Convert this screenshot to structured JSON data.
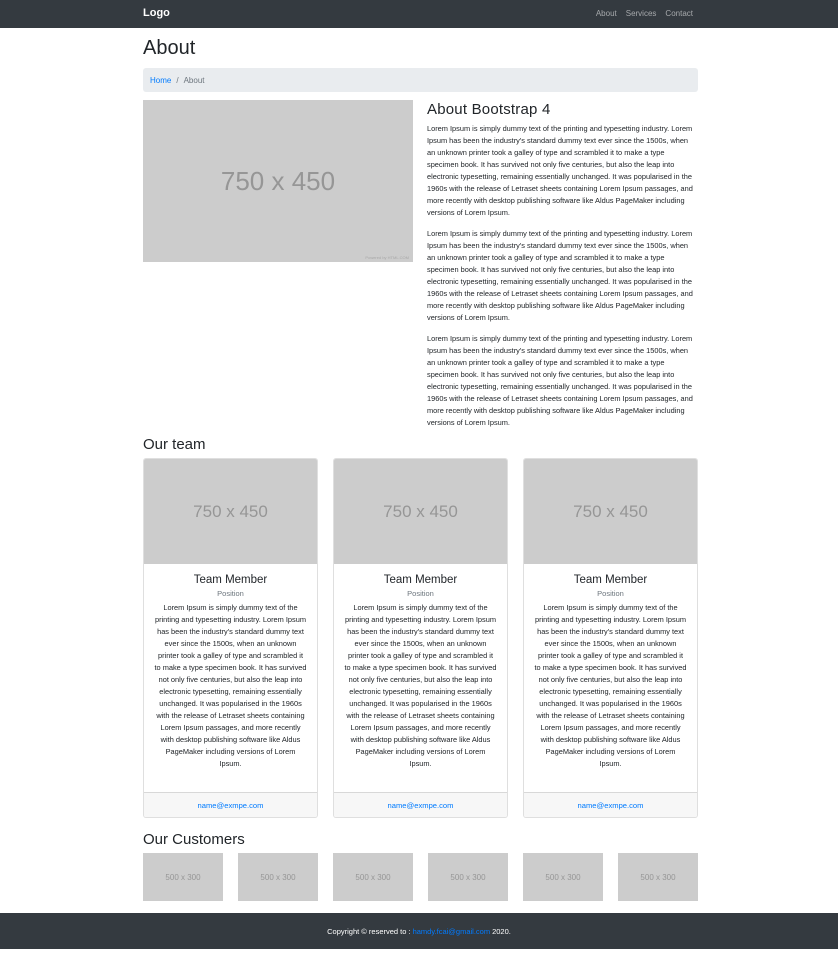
{
  "navbar": {
    "brand": "Logo",
    "links": [
      "About",
      "Services",
      "Contact"
    ]
  },
  "page": {
    "title": "About"
  },
  "breadcrumb": {
    "home": "Home",
    "separator": "/",
    "current": "About"
  },
  "hero": {
    "image_label": "750 x 450",
    "watermark": "Powered by HTML.COM",
    "heading": "About Bootstrap 4",
    "paragraphs": [
      "Lorem Ipsum is simply dummy text of the printing and typesetting industry. Lorem Ipsum has been the industry's standard dummy text ever since the 1500s, when an unknown printer took a galley of type and scrambled it to make a type specimen book. It has survived not only five centuries, but also the leap into electronic typesetting, remaining essentially unchanged. It was popularised in the 1960s with the release of Letraset sheets containing Lorem Ipsum passages, and more recently with desktop publishing software like Aldus PageMaker including versions of Lorem Ipsum.",
      "Lorem Ipsum is simply dummy text of the printing and typesetting industry. Lorem Ipsum has been the industry's standard dummy text ever since the 1500s, when an unknown printer took a galley of type and scrambled it to make a type specimen book. It has survived not only five centuries, but also the leap into electronic typesetting, remaining essentially unchanged. It was popularised in the 1960s with the release of Letraset sheets containing Lorem Ipsum passages, and more recently with desktop publishing software like Aldus PageMaker including versions of Lorem Ipsum.",
      "Lorem Ipsum is simply dummy text of the printing and typesetting industry. Lorem Ipsum has been the industry's standard dummy text ever since the 1500s, when an unknown printer took a galley of type and scrambled it to make a type specimen book. It has survived not only five centuries, but also the leap into electronic typesetting, remaining essentially unchanged. It was popularised in the 1960s with the release of Letraset sheets containing Lorem Ipsum passages, and more recently with desktop publishing software like Aldus PageMaker including versions of Lorem Ipsum."
    ]
  },
  "team": {
    "title": "Our team",
    "members": [
      {
        "image_label": "750 x 450",
        "name": "Team Member",
        "position": "Position",
        "description": "Lorem Ipsum is simply dummy text of the printing and typesetting industry. Lorem Ipsum has been the industry's standard dummy text ever since the 1500s, when an unknown printer took a galley of type and scrambled it to make a type specimen book. It has survived not only five centuries, but also the leap into electronic typesetting, remaining essentially unchanged. It was popularised in the 1960s with the release of Letraset sheets containing Lorem Ipsum passages, and more recently with desktop publishing software like Aldus PageMaker including versions of Lorem Ipsum.",
        "email": "name@exmpe.com"
      },
      {
        "image_label": "750 x 450",
        "name": "Team Member",
        "position": "Position",
        "description": "Lorem Ipsum is simply dummy text of the printing and typesetting industry. Lorem Ipsum has been the industry's standard dummy text ever since the 1500s, when an unknown printer took a galley of type and scrambled it to make a type specimen book. It has survived not only five centuries, but also the leap into electronic typesetting, remaining essentially unchanged. It was popularised in the 1960s with the release of Letraset sheets containing Lorem Ipsum passages, and more recently with desktop publishing software like Aldus PageMaker including versions of Lorem Ipsum.",
        "email": "name@exmpe.com"
      },
      {
        "image_label": "750 x 450",
        "name": "Team Member",
        "position": "Position",
        "description": "Lorem Ipsum is simply dummy text of the printing and typesetting industry. Lorem Ipsum has been the industry's standard dummy text ever since the 1500s, when an unknown printer took a galley of type and scrambled it to make a type specimen book. It has survived not only five centuries, but also the leap into electronic typesetting, remaining essentially unchanged. It was popularised in the 1960s with the release of Letraset sheets containing Lorem Ipsum passages, and more recently with desktop publishing software like Aldus PageMaker including versions of Lorem Ipsum.",
        "email": "name@exmpe.com"
      }
    ]
  },
  "customers": {
    "title": "Our Customers",
    "logos": [
      "500 x 300",
      "500 x 300",
      "500 x 300",
      "500 x 300",
      "500 x 300",
      "500 x 300"
    ]
  },
  "footer": {
    "prefix": "Copyright © reserved to :",
    "email": "hamdy.fcai@gmail.com",
    "suffix": "2020."
  }
}
